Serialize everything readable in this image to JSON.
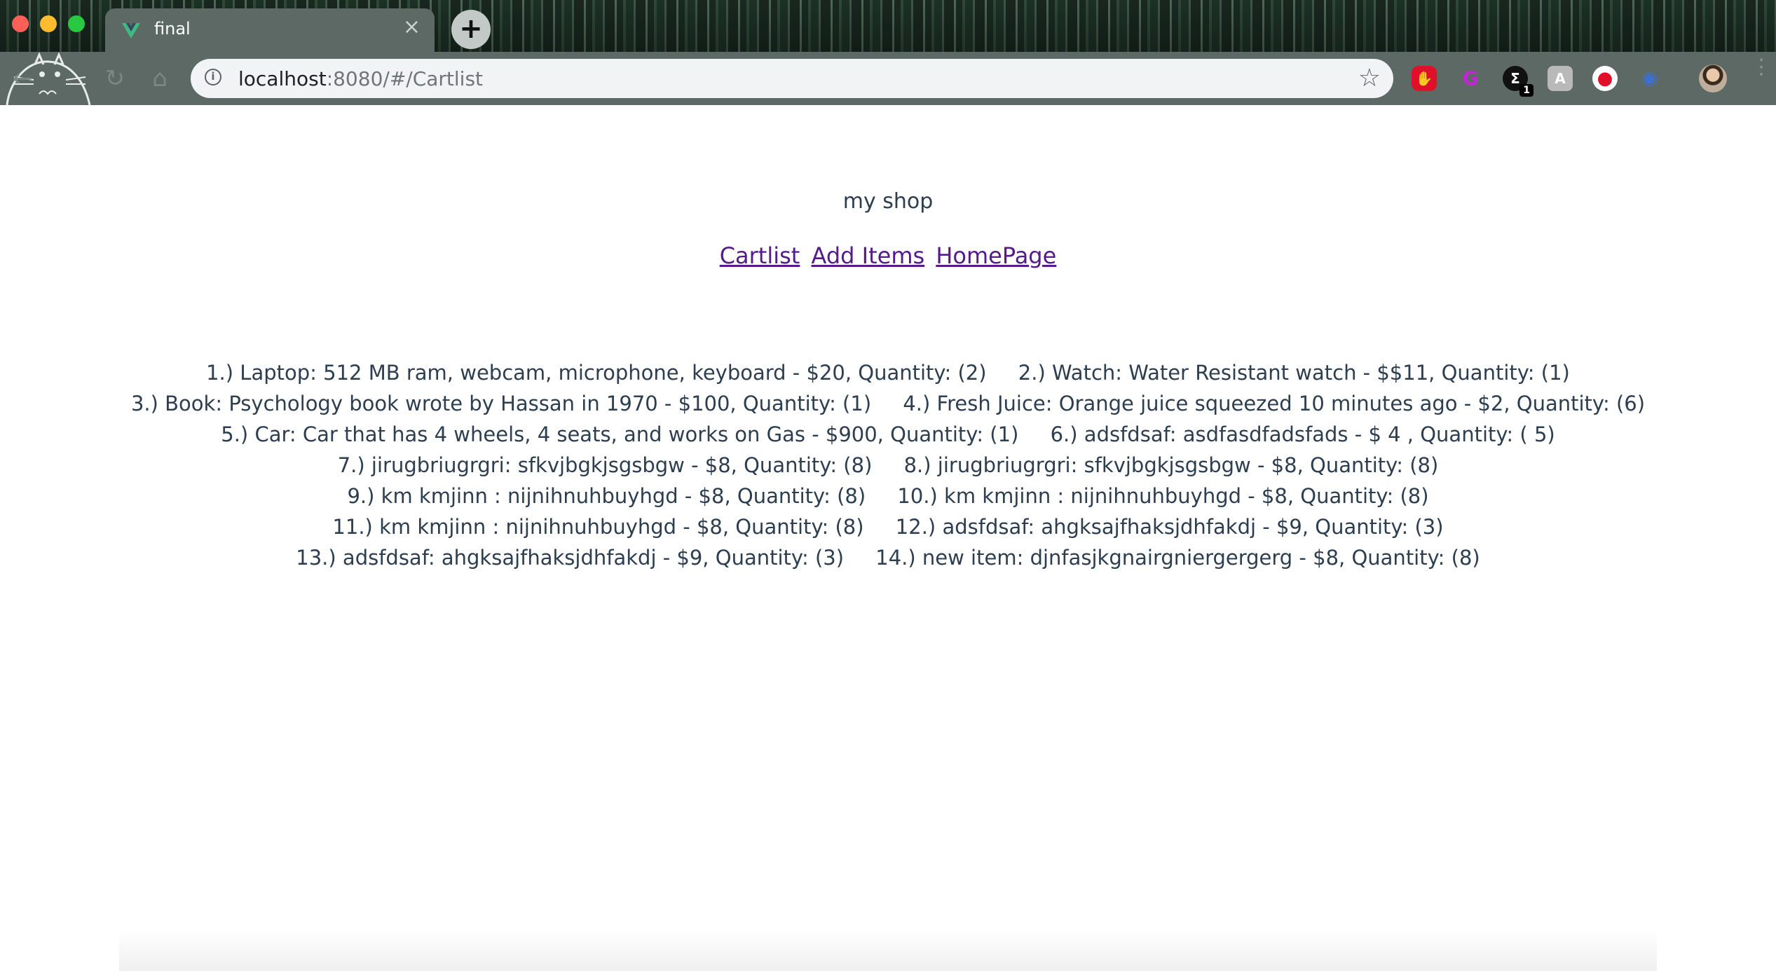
{
  "browser": {
    "tab_title": "final",
    "tab_close": "×",
    "new_tab": "+",
    "url_host": "localhost",
    "url_rest": ":8080/#/Cartlist",
    "extensions": [
      {
        "name": "adblock",
        "color": "#e0102b",
        "glyph": "✋"
      },
      {
        "name": "grammar",
        "color": "#9c27b0",
        "glyph": "G"
      },
      {
        "name": "sigma",
        "color": "#111111",
        "glyph": "Σ",
        "badge": "1"
      },
      {
        "name": "keep",
        "color": "#b9b9b9",
        "glyph": "A"
      },
      {
        "name": "record",
        "color": "#ffffff",
        "glyph": "●"
      },
      {
        "name": "eyes",
        "color": "#3b6fd6",
        "glyph": "◉"
      }
    ]
  },
  "page": {
    "title": "my shop",
    "nav": [
      "Cartlist",
      "Add Items",
      "HomePage"
    ],
    "cart_items": [
      "1.) Laptop: 512 MB ram, webcam, microphone, keyboard - $20, Quantity: (2)",
      "2.) Watch: Water Resistant watch - $$11, Quantity: (1)",
      "3.) Book: Psychology book wrote by Hassan in 1970 - $100, Quantity: (1)",
      "4.) Fresh Juice: Orange juice squeezed 10 minutes ago - $2, Quantity: (6)",
      "5.) Car: Car that has 4 wheels, 4 seats, and works on Gas - $900, Quantity: (1)",
      "6.) adsfdsaf: asdfasdfadsfads - $ 4 , Quantity: ( 5)",
      "7.) jirugbriugrgri: sfkvjbgkjsgsbgw - $8, Quantity: (8)",
      "8.) jirugbriugrgri: sfkvjbgkjsgsbgw - $8, Quantity: (8)",
      "9.) km kmjinn : nijnihnuhbuyhgd - $8, Quantity: (8)",
      "10.) km kmjinn : nijnihnuhbuyhgd - $8, Quantity: (8)",
      "11.) km kmjinn : nijnihnuhbuyhgd - $8, Quantity: (8)",
      "12.) adsfdsaf: ahgksajfhaksjdhfakdj - $9, Quantity: (3)",
      "13.) adsfdsaf: ahgksajfhaksjdhfakdj - $9, Quantity: (3)",
      "14.) new item: djnfasjkgnairgniergergerg - $8, Quantity: (8)"
    ]
  }
}
